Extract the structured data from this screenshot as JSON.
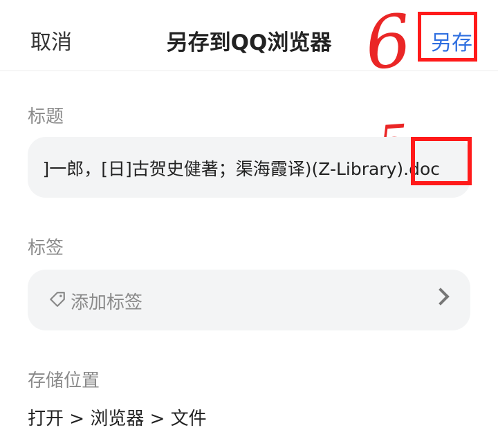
{
  "header": {
    "cancel_label": "取消",
    "title": "另存到QQ浏览器",
    "save_as_label": "另存"
  },
  "annotations": {
    "step_6": "6",
    "step_5": "5"
  },
  "form": {
    "title_label": "标题",
    "title_value": "]一郎，[日]古贺史健著；渠海霞译)(Z-Library).doc",
    "tags_label": "标签",
    "tags_placeholder": "添加标签",
    "storage_label": "存储位置",
    "storage_path": "打开 > 浏览器 > 文件"
  },
  "colors": {
    "accent": "#2f6fe0",
    "annotation_red": "#ff1a1a",
    "field_bg": "#f3f4f5"
  },
  "icons": {
    "tag": "tag-icon",
    "chevron": "chevron-right-icon"
  }
}
